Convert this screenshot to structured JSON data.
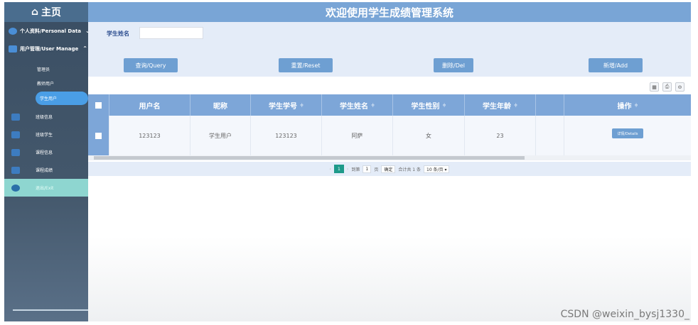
{
  "sidebar": {
    "home": "主页",
    "personal": "个人资料/Personal Data",
    "user_manage": "用户管理/User Manage",
    "sub_items": [
      "管理员",
      "教师用户"
    ],
    "active_item": "学生用户",
    "menu": [
      "班级信息",
      "班级学生",
      "课程信息",
      "课程成绩"
    ],
    "exit": "退出/Exit"
  },
  "header": {
    "title": "欢迎使用学生成绩管理系统"
  },
  "search": {
    "label": "学生姓名",
    "value": ""
  },
  "buttons": {
    "query": "查询/Query",
    "reset": "重置/Reset",
    "delete": "删除/Del",
    "add": "新增/Add"
  },
  "table": {
    "headers": [
      "用户名",
      "昵称",
      "学生学号",
      "学生姓名",
      "学生性别",
      "学生年龄",
      "",
      "操作"
    ],
    "sort_mark": "≑",
    "rows": [
      {
        "username": "123123",
        "nickname": "学生用户",
        "student_no": "123123",
        "name": "阿萨",
        "gender": "女",
        "age": "23",
        "extra": "",
        "action": "详情/Details"
      }
    ]
  },
  "pager": {
    "prev": "‹",
    "current": "1",
    "next": "›",
    "goto_label": "到第",
    "goto_value": "1",
    "page_unit": "页",
    "confirm": "确定",
    "total": "合计共 1 条",
    "page_size": "10 条/页 ▾"
  },
  "watermark": "CSDN @weixin_bysj1330_"
}
